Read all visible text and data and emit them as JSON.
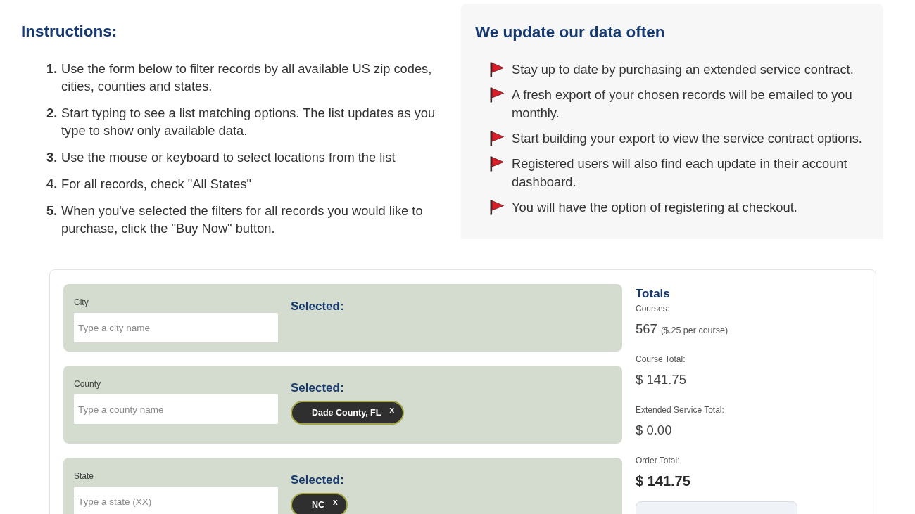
{
  "instructions": {
    "title": "Instructions:",
    "steps": [
      {
        "number": "1.",
        "text": "Use the form below to filter records by all available US zip codes, cities, counties and states."
      },
      {
        "number": "2.",
        "text": "Start typing to see a list matching options. The list updates as you type to show only available data."
      },
      {
        "number": "3.",
        "text": "Use the mouse or keyboard to select locations from the list"
      },
      {
        "number": "4.",
        "text": "For all records, check \"All States\""
      },
      {
        "number": "5.",
        "text": "When you've selected the filters for all records you would like to purchase, click the \"Buy Now\" button."
      }
    ]
  },
  "updates_panel": {
    "title": "We update our data often",
    "items": [
      "Stay up to date by purchasing an extended service contract.",
      "A fresh export of your chosen records will be emailed to you monthly.",
      "Start building your export to view the service contract options.",
      "Registered users will also find each update in their account dashboard.",
      "You will have the option of registering at checkout."
    ]
  },
  "filters": [
    {
      "label": "City",
      "placeholder": "Type a city name",
      "selected_label": "Selected:"
    },
    {
      "label": "County",
      "placeholder": "Type a county name",
      "selected_label": "Selected:",
      "chips": [
        {
          "text": "Dade County, FL",
          "remove": "x"
        }
      ]
    },
    {
      "label": "State",
      "placeholder": "Type a state (XX)",
      "selected_label": "Selected:",
      "chips": [
        {
          "text": "NC",
          "remove": "x"
        }
      ]
    }
  ],
  "totals": {
    "title": "Totals",
    "rows": [
      {
        "label": "Courses:",
        "value": "567",
        "note": "($.25 per course)",
        "emphasized": false
      },
      {
        "label": "Course Total:",
        "value": "$ 141.75",
        "emphasized": false
      },
      {
        "label": "Extended Service Total:",
        "value": "$ 0.00",
        "emphasized": false
      },
      {
        "label": "Order Total:",
        "value": "$ 141.75",
        "emphasized": true
      }
    ]
  }
}
